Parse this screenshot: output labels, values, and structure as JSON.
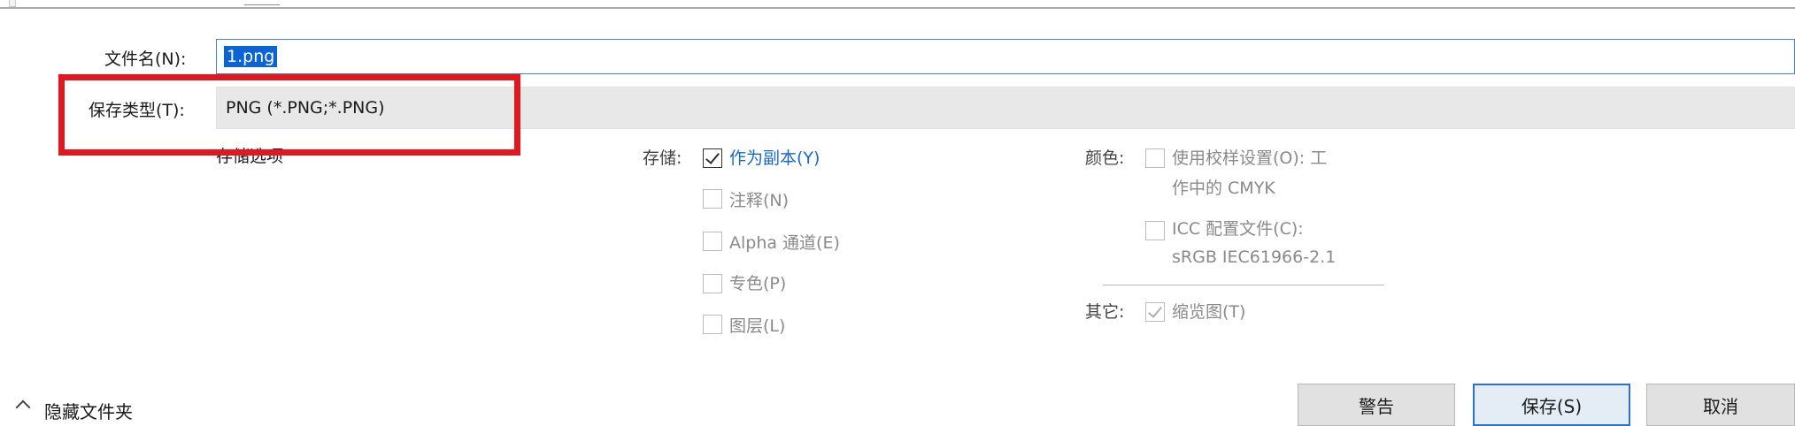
{
  "file_name": {
    "label": "文件名(N):",
    "value": "1.png"
  },
  "save_type": {
    "label": "保存类型(T):",
    "value": "PNG (*.PNG;*.PNG)"
  },
  "save_options": {
    "title": "存储选项"
  },
  "storage": {
    "label": "存储:",
    "items": [
      {
        "label": "作为副本(Y)",
        "checked": true,
        "enabled": true
      },
      {
        "label": "注释(N)",
        "checked": false,
        "enabled": false
      },
      {
        "label": "Alpha 通道(E)",
        "checked": false,
        "enabled": false
      },
      {
        "label": "专色(P)",
        "checked": false,
        "enabled": false
      },
      {
        "label": "图层(L)",
        "checked": false,
        "enabled": false
      }
    ]
  },
  "color": {
    "label": "颜色:",
    "proof_line1": "使用校样设置(O): 工",
    "proof_line2": "作中的 CMYK",
    "icc_line1": "ICC 配置文件(C):",
    "icc_line2": "sRGB IEC61966-2.1"
  },
  "other": {
    "label": "其它:",
    "thumbnail_label": "缩览图(T)",
    "thumbnail_checked": true
  },
  "hide_folders_label": "隐藏文件夹",
  "buttons": {
    "warning": "警告",
    "save": "保存(S)",
    "cancel": "取消"
  },
  "colors": {
    "accent": "#0a64d6",
    "highlight_box": "#e0181f",
    "link_blue": "#1668c8"
  }
}
